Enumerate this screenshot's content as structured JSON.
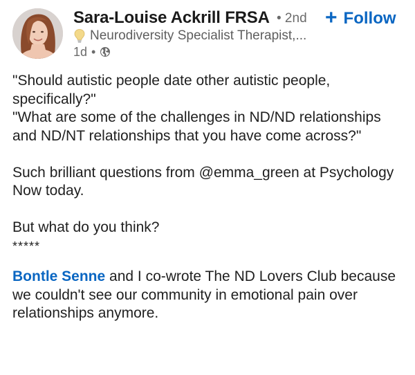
{
  "header": {
    "author_name": "Sara-Louise Ackrill FRSA",
    "degree": "• 2nd",
    "follow_label": "Follow",
    "follow_icon": "plus-icon",
    "headline_icon": "lightbulb-icon",
    "headline": "Neurodiversity Specialist Therapist,...",
    "time": "1d",
    "visibility_icon": "globe-icon"
  },
  "post": {
    "line1": "\"Should autistic people date other autistic people, specifically?\"",
    "line2": "\"What are some of the challenges in ND/ND relationships and ND/NT relationships that you have come across?\"",
    "para2": "Such brilliant questions from @emma_green at Psychology Now today.",
    "para3": "But what do you think?",
    "separator": "*****",
    "mention": "Bontle Senne",
    "para4_rest": " and I co-wrote The ND Lovers Club because we couldn't see our community in emotional pain over relationships anymore."
  },
  "colors": {
    "link_blue": "#0a66c2",
    "text": "#1f1f1f",
    "muted": "#6b6b6b"
  }
}
